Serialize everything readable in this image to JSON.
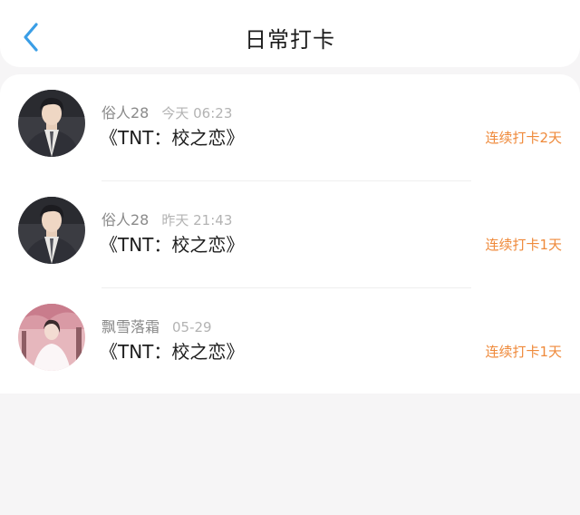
{
  "header": {
    "title": "日常打卡",
    "back_icon": "chevron-left-icon"
  },
  "colors": {
    "accent_blue": "#3a9ee6",
    "streak_orange": "#ef8a3b",
    "background": "#f6f5f6"
  },
  "checkins": [
    {
      "username": "俗人28",
      "time": "今天 06:23",
      "book": "《TNT：校之恋》",
      "streak": "连续打卡2天",
      "avatar": "avatar-icon"
    },
    {
      "username": "俗人28",
      "time": "昨天 21:43",
      "book": "《TNT：校之恋》",
      "streak": "连续打卡1天",
      "avatar": "avatar-icon"
    },
    {
      "username": "飘雪落霜",
      "time": "05-29",
      "book": "《TNT：校之恋》",
      "streak": "连续打卡1天",
      "avatar": "avatar-icon"
    }
  ]
}
